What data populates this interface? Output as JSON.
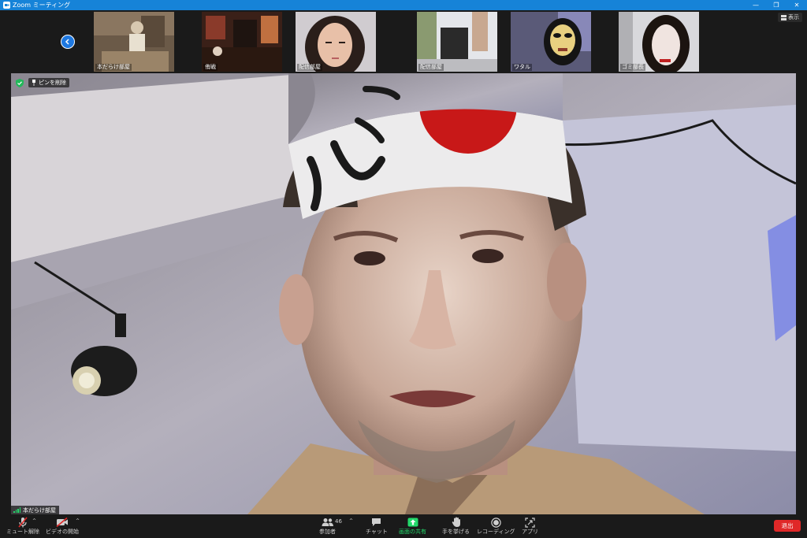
{
  "window": {
    "title": "Zoom ミーティング",
    "accent": "#1683d8"
  },
  "top_bar": {
    "view_label": "表示"
  },
  "participants": [
    {
      "name": "本だらけ部屋"
    },
    {
      "name": "侑戦"
    },
    {
      "name": "配信部屋"
    },
    {
      "name": "配信部屋"
    },
    {
      "name": "ワタル"
    },
    {
      "name": "ゴミ部長"
    }
  ],
  "main_video": {
    "pin_label": "ピンを削除",
    "speaker_name": "本だらけ部屋"
  },
  "toolbar": {
    "mute_label": "ミュート解除",
    "video_label": "ビデオの開始",
    "participants_label": "参加者",
    "participants_count": "46",
    "chat_label": "チャット",
    "share_label": "画面の共有",
    "raise_hand_label": "手を挙げる",
    "record_label": "レコーディング",
    "apps_label": "アプリ",
    "leave_label": "退出",
    "share_color": "#23d96b",
    "leave_color": "#e02828"
  }
}
